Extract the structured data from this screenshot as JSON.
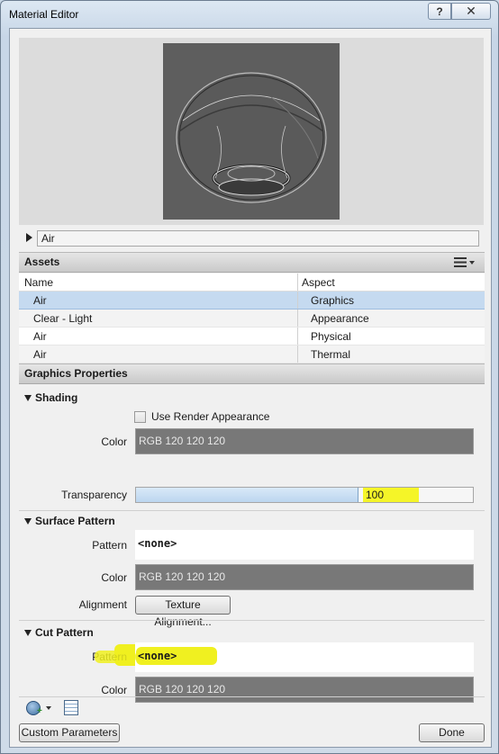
{
  "window": {
    "title": "Material Editor",
    "help_label": "?",
    "close_label": "✕"
  },
  "material_name": "Air",
  "assets": {
    "header": "Assets",
    "columns": {
      "name": "Name",
      "aspect": "Aspect"
    },
    "rows": [
      {
        "name": "Air",
        "aspect": "Graphics",
        "selected": true
      },
      {
        "name": "Clear - Light",
        "aspect": "Appearance"
      },
      {
        "name": "Air",
        "aspect": "Physical"
      },
      {
        "name": "Air",
        "aspect": "Thermal"
      }
    ]
  },
  "graphics": {
    "header": "Graphics Properties",
    "shading": {
      "title": "Shading",
      "use_render_label": "Use Render Appearance",
      "use_render_checked": false,
      "color_label": "Color",
      "color_value": "RGB 120 120 120",
      "transparency_label": "Transparency",
      "transparency_value": "100",
      "transparency_fraction": 0.66
    },
    "surface": {
      "title": "Surface Pattern",
      "pattern_label": "Pattern",
      "pattern_value": "<none>",
      "color_label": "Color",
      "color_value": "RGB 120 120 120",
      "alignment_label": "Alignment",
      "alignment_button": "Texture Alignment..."
    },
    "cut": {
      "title": "Cut Pattern",
      "pattern_label": "Pattern",
      "pattern_value": "<none>",
      "color_label": "Color",
      "color_value": "RGB 120 120 120"
    }
  },
  "buttons": {
    "custom_parameters": "Custom Parameters",
    "done": "Done"
  },
  "colors": {
    "swatch": "#787878",
    "selection": "#c5daf0",
    "highlight": "#f0f020"
  }
}
